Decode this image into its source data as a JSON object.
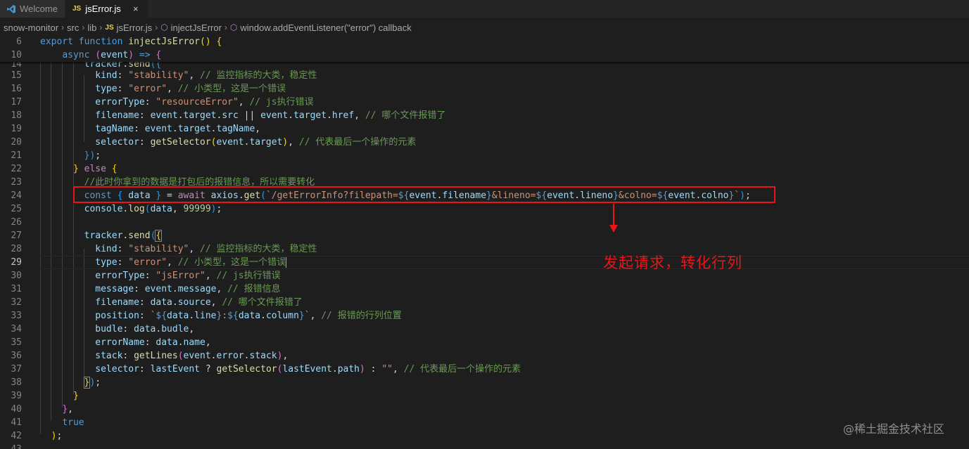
{
  "tabs": [
    {
      "label": "Welcome",
      "icon": "vscode-icon",
      "active": false
    },
    {
      "label": "jsError.js",
      "icon": "js-file-icon",
      "icon_text": "JS",
      "active": true,
      "close": "×"
    }
  ],
  "breadcrumb": {
    "items": [
      "snow-monitor",
      "src",
      "lib",
      "jsError.js",
      "injectJsError",
      "window.addEventListener(\"error\") callback"
    ],
    "file_icon_text": "JS"
  },
  "line_numbers": [
    "6",
    "10",
    "14",
    "15",
    "16",
    "17",
    "18",
    "19",
    "20",
    "21",
    "22",
    "23",
    "24",
    "25",
    "26",
    "27",
    "28",
    "29",
    "30",
    "31",
    "32",
    "33",
    "34",
    "35",
    "36",
    "37",
    "38",
    "39",
    "40",
    "41",
    "42",
    "43"
  ],
  "current_line": "29",
  "annotation": {
    "text": "发起请求，转化行列",
    "color": "#e8161b"
  },
  "watermark": "@稀土掘金技术社区",
  "colors": {
    "background": "#1e1e1e",
    "highlight": "#e8161b",
    "keyword": "#569cd6",
    "string": "#ce9178",
    "comment": "#6a9955"
  }
}
